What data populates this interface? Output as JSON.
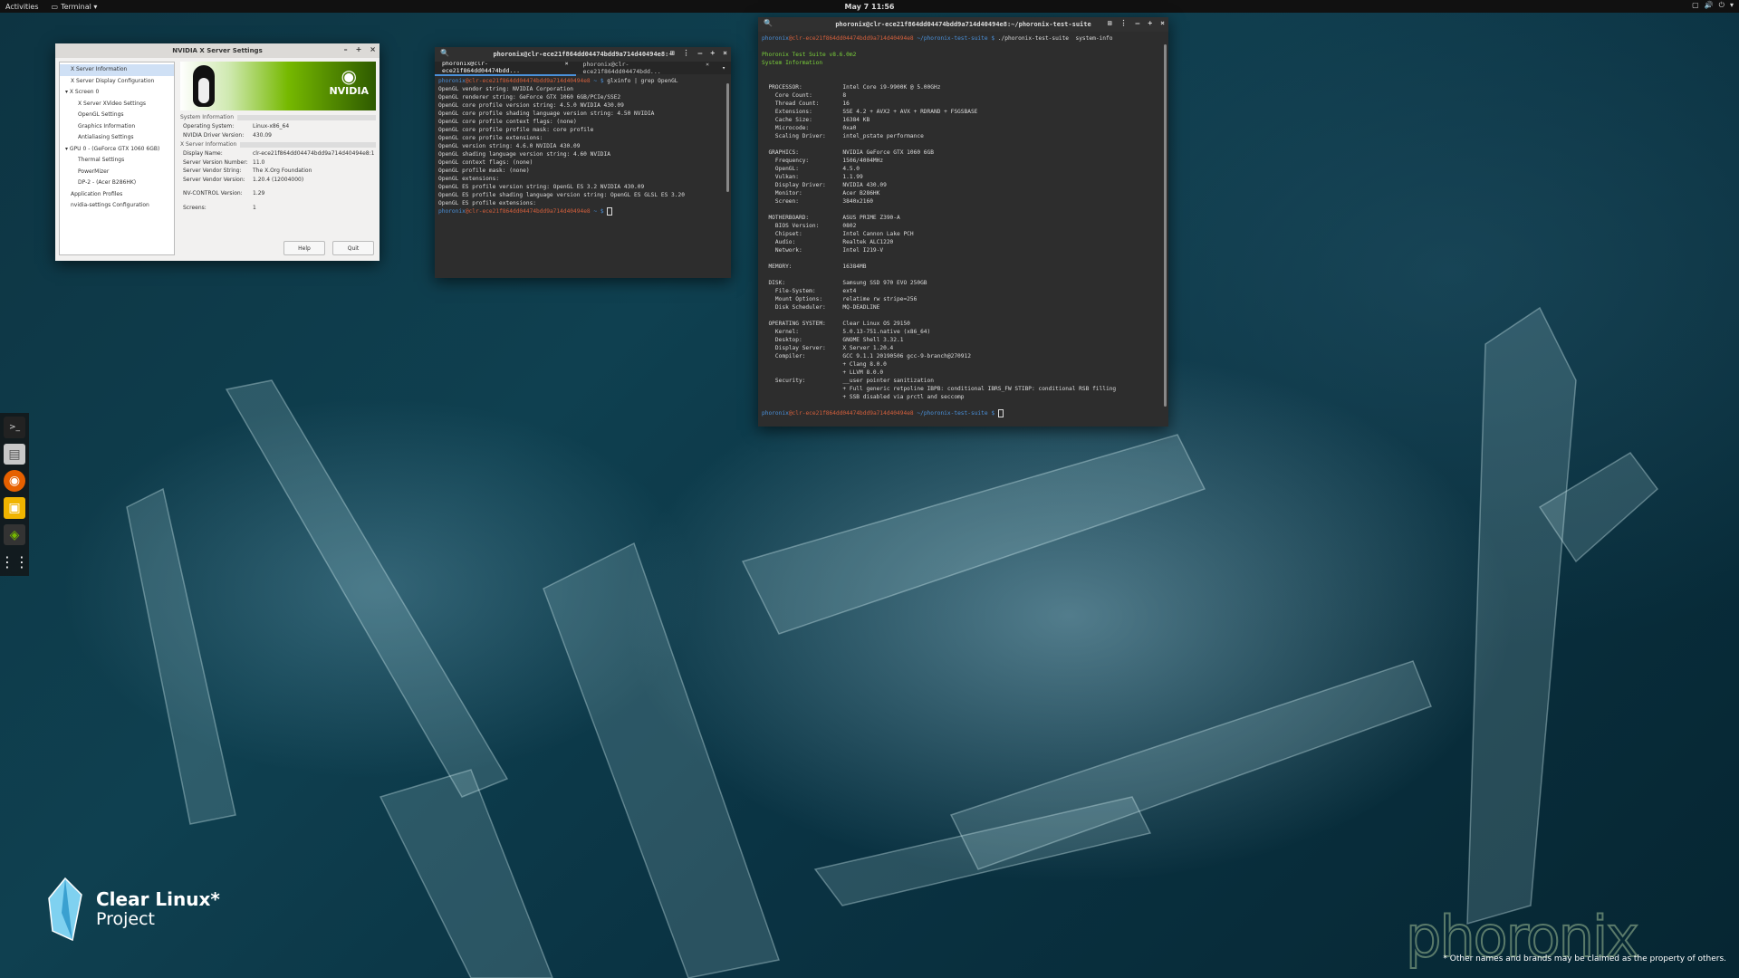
{
  "topbar": {
    "activities": "Activities",
    "app_menu": "Terminal ▾",
    "clock": "May 7  11:56"
  },
  "nvidia_window": {
    "title": "NVIDIA X Server Settings",
    "tree": [
      "X Server Information",
      "X Server Display Configuration",
      "▾ X Screen 0",
      "X Server XVideo Settings",
      "OpenGL Settings",
      "Graphics Information",
      "Antialiasing Settings",
      "▾ GPU 0 - (GeForce GTX 1060 6GB)",
      "Thermal Settings",
      "PowerMizer",
      "DP-2 - (Acer B286HK)",
      "Application Profiles",
      "nvidia-settings Configuration"
    ],
    "banner_logo": "NVIDIA",
    "section_system": "System Information",
    "system": [
      {
        "k": "Operating System:",
        "v": "Linux-x86_64"
      },
      {
        "k": "NVIDIA Driver Version:",
        "v": "430.09"
      }
    ],
    "section_xserver": "X Server Information",
    "xserver": [
      {
        "k": "Display Name:",
        "v": "clr-ece21f864dd04474bdd9a714d40494e8:1"
      },
      {
        "k": "Server Version Number:",
        "v": "11.0"
      },
      {
        "k": "Server Vendor String:",
        "v": "The X.Org Foundation"
      },
      {
        "k": "Server Vendor Version:",
        "v": "1.20.4 (12004000)"
      },
      {
        "k": "NV-CONTROL Version:",
        "v": "1.29"
      },
      {
        "k": "Screens:",
        "v": "1"
      }
    ],
    "help": "Help",
    "quit": "Quit"
  },
  "terminal1": {
    "title": "phoronix@clr-ece21f864dd04474bdd9a714d40494e8:~",
    "tab1": "phoronix@clr-ece21f864dd04474bdd...",
    "tab2": "phoronix@clr-ece21f864dd04474bdd...",
    "prompt_user": "phoronix",
    "prompt_host": "@clr-ece21f864dd04474bdd9a714d40494e8",
    "prompt_path": " ~ $ ",
    "command": "glxinfo | grep OpenGL",
    "output": "OpenGL vendor string: NVIDIA Corporation\nOpenGL renderer string: GeForce GTX 1060 6GB/PCIe/SSE2\nOpenGL core profile version string: 4.5.0 NVIDIA 430.09\nOpenGL core profile shading language version string: 4.50 NVIDIA\nOpenGL core profile context flags: (none)\nOpenGL core profile profile mask: core profile\nOpenGL core profile extensions:\nOpenGL version string: 4.6.0 NVIDIA 430.09\nOpenGL shading language version string: 4.60 NVIDIA\nOpenGL context flags: (none)\nOpenGL profile mask: (none)\nOpenGL extensions:\nOpenGL ES profile version string: OpenGL ES 3.2 NVIDIA 430.09\nOpenGL ES profile shading language version string: OpenGL ES GLSL ES 3.20\nOpenGL ES profile extensions:"
  },
  "terminal2": {
    "title": "phoronix@clr-ece21f864dd04474bdd9a714d40494e8:~/phoronix-test-suite",
    "prompt_user": "phoronix",
    "prompt_host": "@clr-ece21f864dd04474bdd9a714d40494e8",
    "prompt_path": " ~/phoronix-test-suite $ ",
    "command": "./phoronix-test-suite  system-info",
    "header1": "Phoronix Test Suite v8.6.0m2",
    "header2": "System Information",
    "output": "\n\n  PROCESSOR:            Intel Core i9-9900K @ 5.00GHz\n    Core Count:         8\n    Thread Count:       16\n    Extensions:         SSE 4.2 + AVX2 + AVX + RDRAND + FSGSBASE\n    Cache Size:         16384 KB\n    Microcode:          0xa0\n    Scaling Driver:     intel_pstate performance\n\n  GRAPHICS:             NVIDIA GeForce GTX 1060 6GB\n    Frequency:          1506/4004MHz\n    OpenGL:             4.5.0\n    Vulkan:             1.1.99\n    Display Driver:     NVIDIA 430.09\n    Monitor:            Acer B286HK\n    Screen:             3840x2160\n\n  MOTHERBOARD:          ASUS PRIME Z390-A\n    BIOS Version:       0802\n    Chipset:            Intel Cannon Lake PCH\n    Audio:              Realtek ALC1220\n    Network:            Intel I219-V\n\n  MEMORY:               16384MB\n\n  DISK:                 Samsung SSD 970 EVO 250GB\n    File-System:        ext4\n    Mount Options:      relatime rw stripe=256\n    Disk Scheduler:     MQ-DEADLINE\n\n  OPERATING SYSTEM:     Clear Linux OS 29150\n    Kernel:             5.0.13-751.native (x86_64)\n    Desktop:            GNOME Shell 3.32.1\n    Display Server:     X Server 1.20.4\n    Compiler:           GCC 9.1.1 20190506 gcc-9-branch@270912\n                        + Clang 8.0.0\n                        + LLVM 8.0.0\n    Security:           __user pointer sanitization\n                        + Full generic retpoline IBPB: conditional IBRS_FW STIBP: conditional RSB filling\n                        + SSB disabled via prctl and seccomp"
  },
  "branding": {
    "clear_line1": "Clear Linux*",
    "clear_line2": "Project",
    "phoronix": "phoronix",
    "disclaimer": "* Other names and brands may be claimed as the property of others."
  },
  "colors": {
    "accent": "#4a90d9",
    "green": "#7ad03a",
    "nvidia": "#76b900"
  }
}
